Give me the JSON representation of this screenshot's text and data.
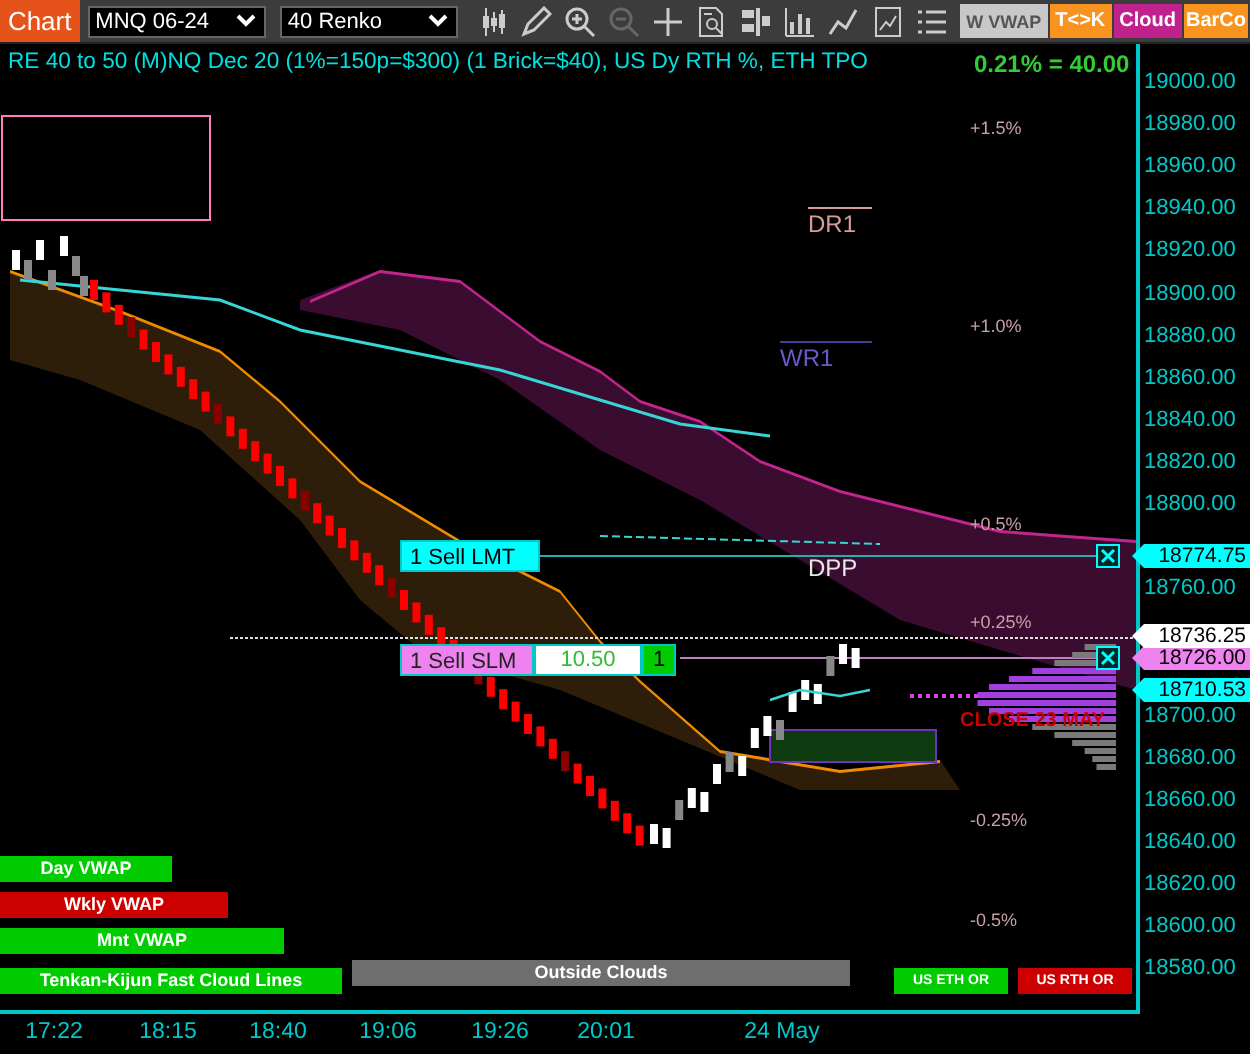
{
  "toolbar": {
    "app_button": "Chart",
    "instrument": "MNQ 06-24",
    "bar_type": "40 Renko",
    "buttons": [
      {
        "label": "W VWAP",
        "color": "#c8c8c8"
      },
      {
        "label": "T<>K",
        "color": "#f7931e"
      },
      {
        "label": "Cloud",
        "color": "#c0218c"
      },
      {
        "label": "BarCo",
        "color": "#f7931e"
      }
    ]
  },
  "chart": {
    "title": "RE 40 to 50 (M)NQ Dec 20 (1%=150p=$300) (1 Brick=$40), US Dy RTH %, ETH TPO",
    "change": "0.21% = 40.00",
    "level_labels": [
      {
        "text": "+1.5%",
        "kind": "percent",
        "color": "#c8a0a8"
      },
      {
        "text": "DR1",
        "kind": "pivot",
        "color": "#d99a9a"
      },
      {
        "text": "+1.0%",
        "kind": "percent",
        "color": "#c8a0a8"
      },
      {
        "text": "WR1",
        "kind": "pivot",
        "color": "#6a5acd"
      },
      {
        "text": "+0.5%",
        "kind": "percent",
        "color": "#c8a0a8"
      },
      {
        "text": "DPP",
        "kind": "pivot",
        "color": "#e6e6e6"
      },
      {
        "text": "+0.25%",
        "kind": "percent",
        "color": "#c8a0a8"
      },
      {
        "text": "CLOSE 23 MAY",
        "kind": "note",
        "color": "#cc0000"
      },
      {
        "text": "-0.25%",
        "kind": "percent",
        "color": "#c8a0a8"
      },
      {
        "text": "-0.5%",
        "kind": "percent",
        "color": "#c8a0a8"
      }
    ],
    "orders": [
      {
        "label": "1 Sell LMT",
        "kind": "limit"
      },
      {
        "label": "1 Sell SLM",
        "kind": "stop",
        "price": "10.50",
        "quantity": "1"
      }
    ],
    "indicator_labels": [
      {
        "text": "Day VWAP",
        "color": "#00cc00"
      },
      {
        "text": "Wkly VWAP",
        "color": "#cc0000"
      },
      {
        "text": "Mnt VWAP",
        "color": "#00cc00"
      },
      {
        "text": "Tenkan-Kijun Fast Cloud Lines",
        "color": "#00cc00"
      },
      {
        "text": "Outside Clouds",
        "color": "#6e6e6e"
      },
      {
        "text": "US ETH OR",
        "color": "#00cc00"
      },
      {
        "text": "US RTH OR",
        "color": "#cc0000"
      }
    ]
  },
  "price_axis": {
    "labels": [
      "19000.00",
      "18980.00",
      "18960.00",
      "18940.00",
      "18920.00",
      "18900.00",
      "18880.00",
      "18860.00",
      "18840.00",
      "18820.00",
      "18800.00",
      "18760.00",
      "18700.00",
      "18680.00",
      "18660.00",
      "18640.00",
      "18620.00",
      "18600.00",
      "18580.00"
    ],
    "markers": [
      {
        "text": "18774.75",
        "color": "#00ffff"
      },
      {
        "text": "18736.25",
        "color": "#ffffff"
      },
      {
        "text": "18726.00",
        "color": "#ee82ee"
      },
      {
        "text": "18710.53",
        "color": "#00ffff"
      }
    ]
  },
  "time_axis": {
    "labels": [
      "17:22",
      "18:15",
      "18:40",
      "19:06",
      "19:26",
      "20:01",
      "24 May"
    ]
  }
}
